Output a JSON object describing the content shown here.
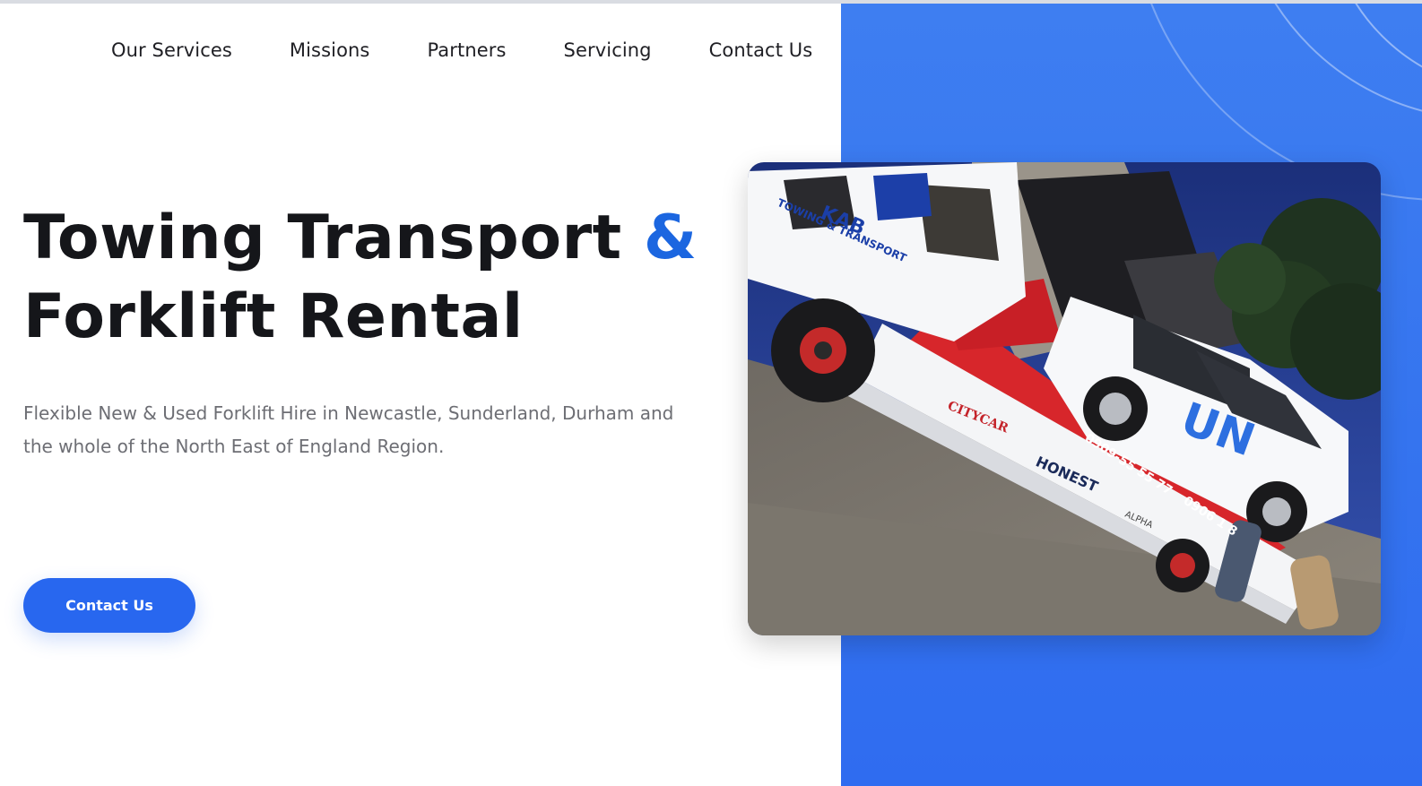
{
  "nav": {
    "items": [
      {
        "label": "Our Services"
      },
      {
        "label": "Missions"
      },
      {
        "label": "Partners"
      },
      {
        "label": "Servicing"
      },
      {
        "label": "Contact Us"
      }
    ]
  },
  "hero": {
    "title_part1": "Towing Transport",
    "title_amp": "&",
    "title_line2": "Forklift Rental",
    "subtitle": "Flexible New & Used Forklift Hire in Newcastle, Sunderland, Durham and the whole of the North East of England Region.",
    "cta_label": "Contact Us"
  },
  "photo": {
    "cab_logo": "KAB",
    "cab_text": "TOWING & TRANSPORT",
    "vehicle_mark": "UN",
    "bed_phone_1": "0909-55 55 77",
    "bed_phone_2": "0906 1 8",
    "sticker_citycar": "CITYCAR",
    "sticker_honest": "HONEST",
    "sticker_alpha": "ALPHA"
  },
  "colors": {
    "accent_blue": "#2867ef",
    "panel_blue": "#3574ef",
    "amp_blue": "#1b66e0",
    "heading": "#15161a",
    "body_text": "#6d6e74"
  }
}
